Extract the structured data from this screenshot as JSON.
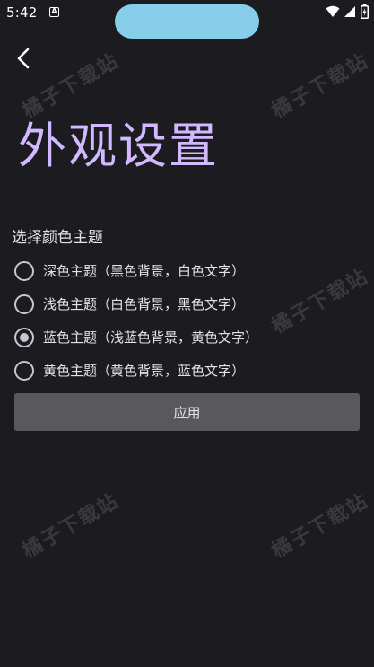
{
  "status_bar": {
    "time": "5:42",
    "notification_icon_glyph": "A",
    "icons": [
      "wifi-icon",
      "signal-icon",
      "battery-charging-icon"
    ]
  },
  "header": {
    "back_icon": "chevron-left-icon",
    "title": "外观设置"
  },
  "theme_section": {
    "label": "选择颜色主题",
    "options": [
      {
        "label": "深色主题（黑色背景，白色文字）",
        "selected": false
      },
      {
        "label": "浅色主题（白色背景，黑色文字）",
        "selected": false
      },
      {
        "label": "蓝色主题（浅蓝色背景，黄色文字）",
        "selected": true
      },
      {
        "label": "黄色主题（黄色背景，蓝色文字）",
        "selected": false
      }
    ]
  },
  "apply_button": {
    "label": "应用"
  },
  "watermark": {
    "text": "橘子下载站"
  },
  "colors": {
    "background": "#1c1b20",
    "title": "#d2b8ff",
    "camera_pill": "#87ceeb",
    "button": "#59585c"
  }
}
